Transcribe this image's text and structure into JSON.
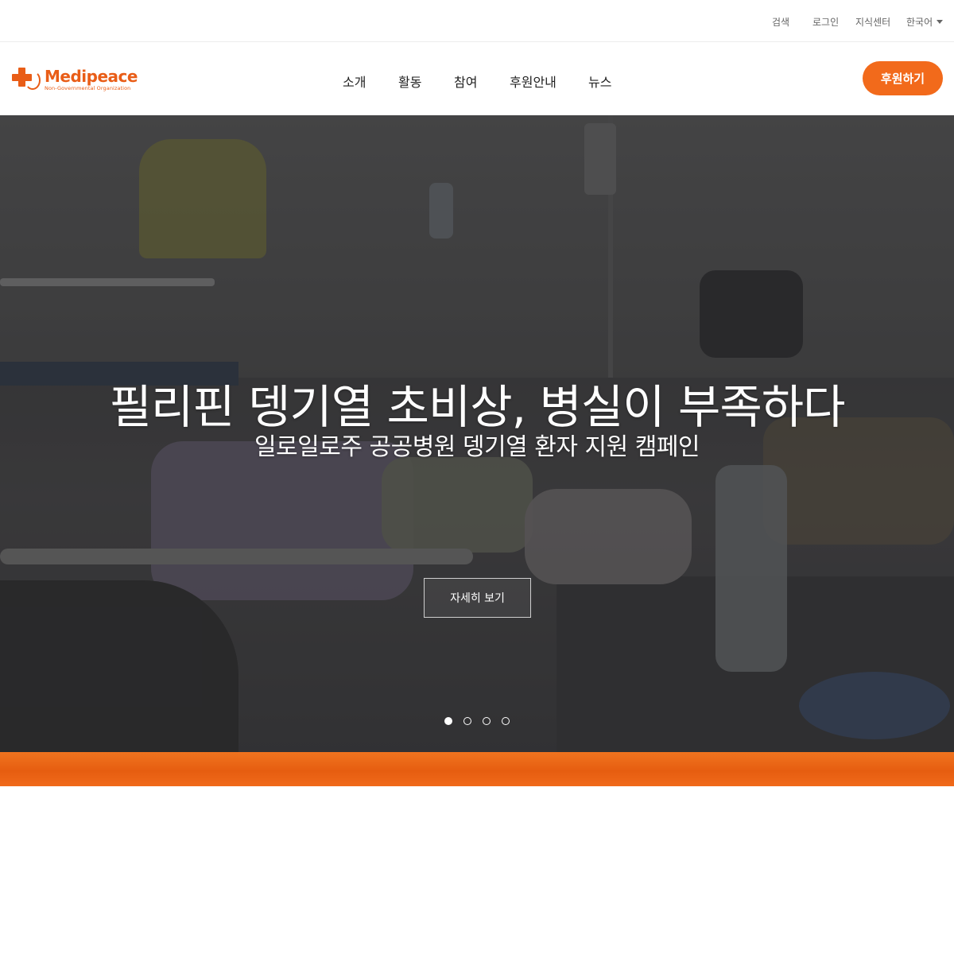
{
  "utility": {
    "search": "검색",
    "login": "로그인",
    "knowledge_center": "지식센터",
    "language": "한국어"
  },
  "header": {
    "logo_name": "Medipeace",
    "logo_tagline": "Non-Governmental Organization",
    "nav": [
      "소개",
      "활동",
      "참여",
      "후원안내",
      "뉴스"
    ],
    "donate_label": "후원하기"
  },
  "hero": {
    "title": "필리핀 뎅기열 초비상, 병실이 부족하다",
    "subtitle": "일로일로주 공공병원 뎅기열 환자 지원 캠페인",
    "button_label": "자세히 보기",
    "slide_count": 4,
    "active_slide": 1
  },
  "colors": {
    "brand_orange": "#f26a1b",
    "logo_orange": "#e95d17"
  },
  "icons": {
    "language_caret": "caret-down-icon",
    "slider_dot": "dot-icon"
  }
}
